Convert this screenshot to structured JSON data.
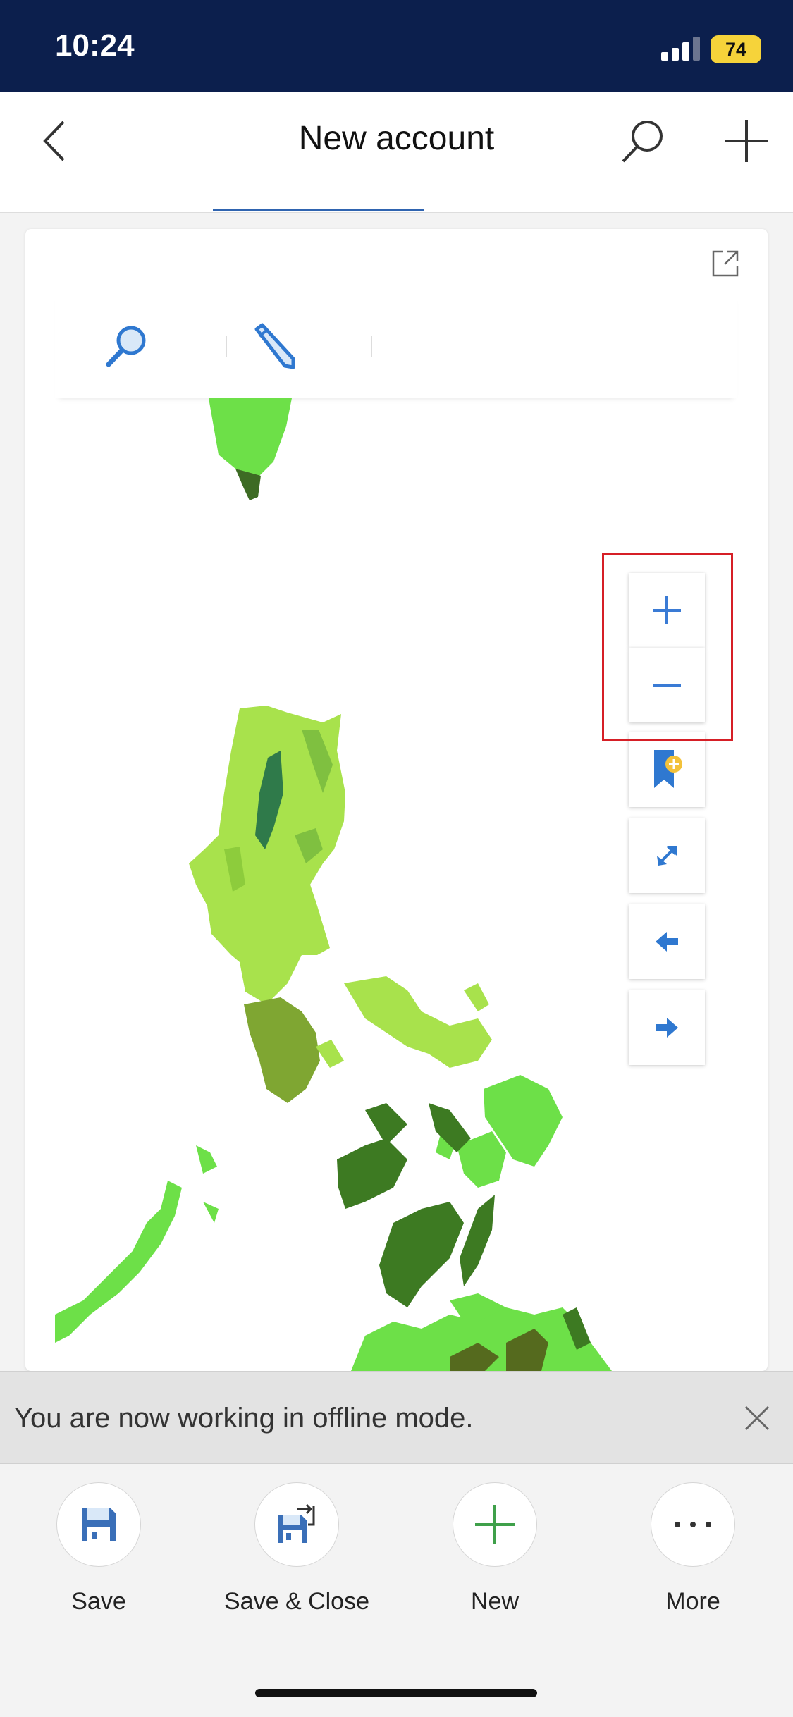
{
  "status_bar": {
    "time": "10:24",
    "battery": "74"
  },
  "header": {
    "title": "New account"
  },
  "icons": {
    "back": "chevron-left-icon",
    "search": "search-icon",
    "add": "plus-icon",
    "expand": "expand-icon",
    "map_search": "search-icon",
    "map_edit": "pencil-icon",
    "zoom_in": "plus-icon",
    "zoom_out": "minus-icon",
    "bookmark": "bookmark-add-icon",
    "fullscreen": "diagonal-arrows-icon",
    "previous": "arrow-left-icon",
    "next": "arrow-right-icon",
    "close": "close-icon",
    "save": "floppy-disk-icon",
    "save_close": "floppy-disk-arrow-icon",
    "new": "plus-icon",
    "more": "ellipsis-icon"
  },
  "colors": {
    "status_bar": "#0c1f4d",
    "accent": "#2f64b0",
    "highlight": "#d61f26",
    "battery": "#f6d33a"
  },
  "offline_banner": {
    "text": "You are now working in offline mode."
  },
  "commands": {
    "save": "Save",
    "save_close": "Save & Close",
    "new": "New",
    "more": "More"
  }
}
